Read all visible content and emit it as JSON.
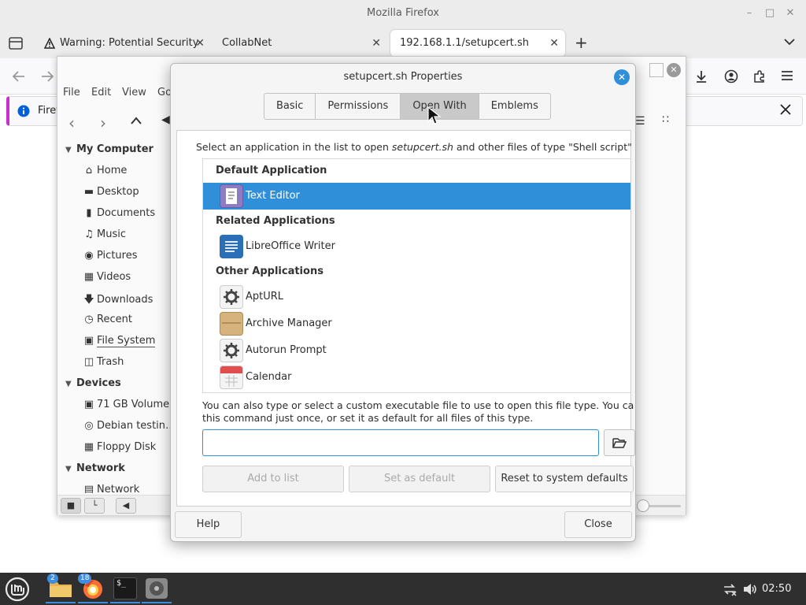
{
  "browser": {
    "title": "Mozilla Firefox",
    "tabs": [
      {
        "label": "Warning: Potential Security"
      },
      {
        "label": "CollabNet"
      },
      {
        "label": "192.168.1.1/setupcert.sh"
      }
    ],
    "new_tab_symbol": "+",
    "notification_text": "Firef"
  },
  "nemo": {
    "menu": [
      "File",
      "Edit",
      "View",
      "Go"
    ],
    "sidebar": {
      "sections": [
        {
          "label": "My Computer"
        },
        {
          "label": "Devices"
        },
        {
          "label": "Network"
        }
      ],
      "my_computer": [
        {
          "label": "Home",
          "icon": "home-icon"
        },
        {
          "label": "Desktop",
          "icon": "desktop-icon"
        },
        {
          "label": "Documents",
          "icon": "documents-icon"
        },
        {
          "label": "Music",
          "icon": "music-icon"
        },
        {
          "label": "Pictures",
          "icon": "camera-icon"
        },
        {
          "label": "Videos",
          "icon": "film-icon"
        },
        {
          "label": "Downloads",
          "icon": "download-icon"
        },
        {
          "label": "Recent",
          "icon": "clock-icon"
        },
        {
          "label": "File System",
          "icon": "drive-icon"
        },
        {
          "label": "Trash",
          "icon": "trash-icon"
        }
      ],
      "devices": [
        {
          "label": "71 GB Volume",
          "icon": "drive-icon"
        },
        {
          "label": "Debian testin…",
          "icon": "disc-icon"
        },
        {
          "label": "Floppy Disk",
          "icon": "floppy-icon"
        }
      ],
      "network": [
        {
          "label": "Network",
          "icon": "network-icon"
        }
      ]
    }
  },
  "dialog": {
    "title": "setupcert.sh Properties",
    "tabs": [
      {
        "label": "Basic"
      },
      {
        "label": "Permissions"
      },
      {
        "label": "Open With"
      },
      {
        "label": "Emblems"
      }
    ],
    "active_tab": "Open With",
    "description": {
      "before": "Select an application in the list to open ",
      "filename": "setupcert.sh",
      "after": " and other files of type \"Shell script\""
    },
    "groups": {
      "default": "Default Application",
      "related": "Related Applications",
      "other": "Other Applications"
    },
    "apps": {
      "default": [
        {
          "label": "Text Editor",
          "icon": "text-editor-icon",
          "selected": true
        }
      ],
      "related": [
        {
          "label": "LibreOffice Writer",
          "icon": "libreoffice-writer-icon"
        }
      ],
      "other": [
        {
          "label": "AptURL",
          "icon": "gear-icon"
        },
        {
          "label": "Archive Manager",
          "icon": "archive-icon"
        },
        {
          "label": "Autorun Prompt",
          "icon": "gear-icon"
        },
        {
          "label": "Calendar",
          "icon": "calendar-icon"
        }
      ]
    },
    "help_text_line1": "You can also type or select a custom executable file to use to open this file type.  You can use",
    "help_text_line2": "this command just once, or set it as default for all files of this type.",
    "command_value": "",
    "buttons": {
      "add_to_list": "Add to list",
      "set_as_default": "Set as default",
      "reset": "Reset to system defaults",
      "help": "Help",
      "close": "Close"
    },
    "close_symbol": "✕"
  },
  "taskbar": {
    "badges": {
      "files": "2",
      "firefox": "18"
    },
    "terminal_label": "$_",
    "clock": "02:50"
  },
  "colors": {
    "accent": "#2f8fd8",
    "taskbar": "#2f2f2f",
    "selection_text": "#ffffff"
  }
}
